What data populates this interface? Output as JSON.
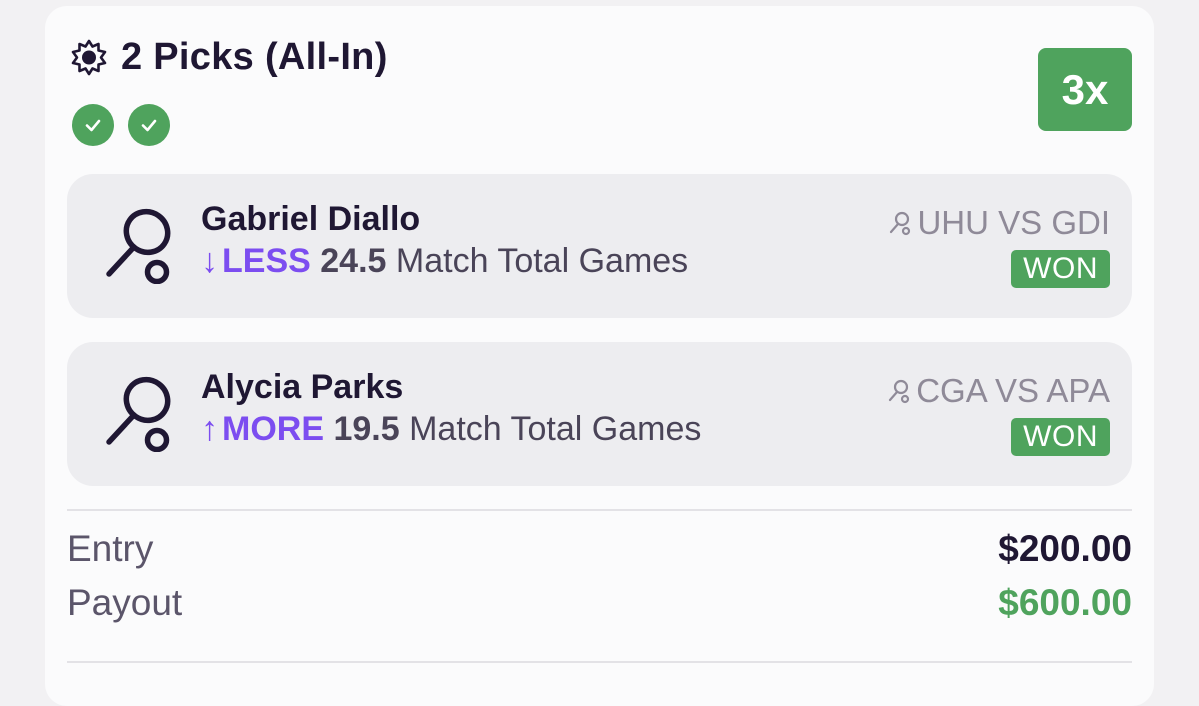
{
  "header": {
    "title": "2 Picks (All-In)",
    "multiplier": "3x",
    "checks": [
      "check",
      "check"
    ]
  },
  "picks": [
    {
      "player": "Gabriel Diallo",
      "direction_arrow": "↓",
      "direction": "LESS",
      "line_value": "24.5",
      "stat": "Match Total Games",
      "matchup": "UHU VS GDI",
      "result": "WON"
    },
    {
      "player": "Alycia Parks",
      "direction_arrow": "↑",
      "direction": "MORE",
      "line_value": "19.5",
      "stat": "Match Total Games",
      "matchup": "CGA VS APA",
      "result": "WON"
    }
  ],
  "summary": {
    "entry_label": "Entry",
    "entry_value": "$200.00",
    "payout_label": "Payout",
    "payout_value": "$600.00"
  },
  "colors": {
    "success_green": "#4fa35d",
    "direction_purple": "#7c4df0",
    "text_dark": "#1f1733"
  },
  "icons": {
    "header": "sun-icon",
    "check": "check-icon",
    "sport": "tennis-racket-icon",
    "matchup": "person-icon"
  }
}
